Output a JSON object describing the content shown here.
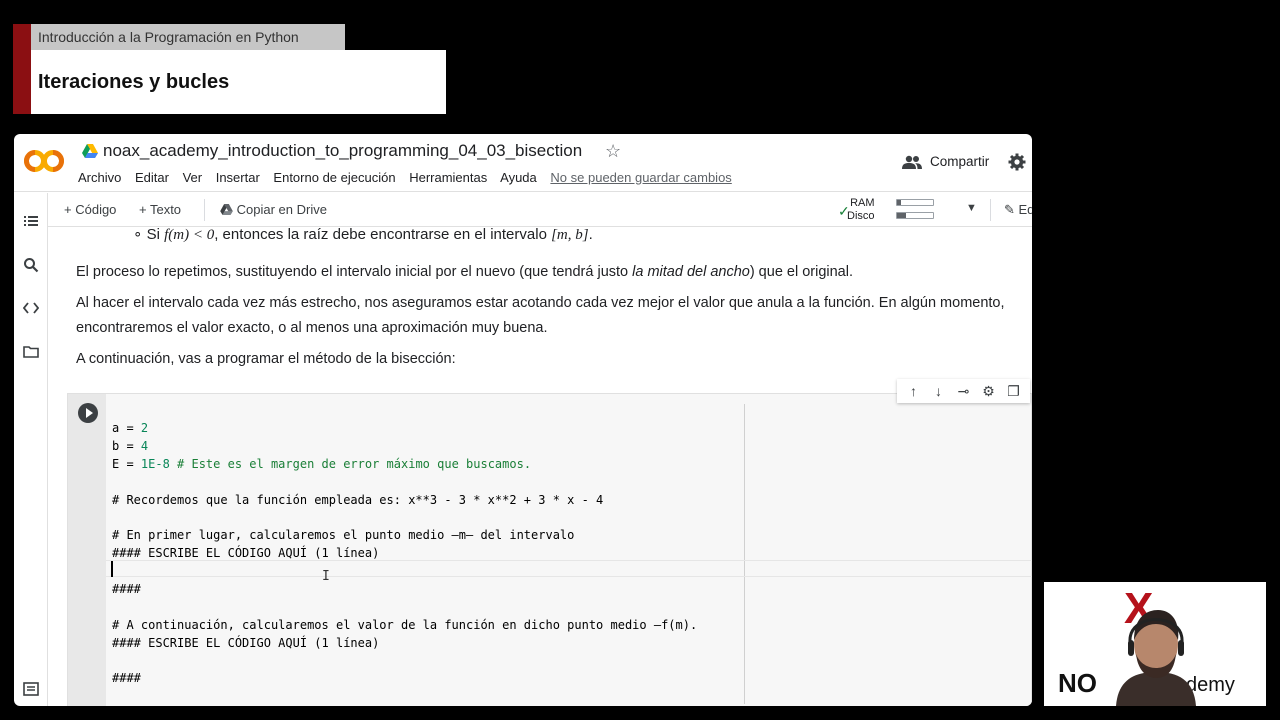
{
  "overlay": {
    "course": "Introducción a la Programación en Python",
    "lesson": "Iteraciones y bucles"
  },
  "header": {
    "notebook_title": "noax_academy_introduction_to_programming_04_03_bisection",
    "menu": [
      "Archivo",
      "Editar",
      "Ver",
      "Insertar",
      "Entorno de ejecución",
      "Herramientas",
      "Ayuda"
    ],
    "unsaved_notice": "No se pueden guardar cambios",
    "share_label": "Compartir"
  },
  "toolbar": {
    "code_label": "Código",
    "text_label": "Texto",
    "drive_label": "Copiar en Drive",
    "ram_label": "RAM",
    "disk_label": "Disco",
    "ram_usage": 0.1,
    "disk_usage": 0.25,
    "edit_label": "Editar"
  },
  "content": {
    "bullet_prefix": "Si",
    "bullet_math": "f(m) < 0",
    "bullet_text": ", entonces la raíz debe encontrarse en el intervalo",
    "bullet_interval": "[m, b]",
    "bullet_end": ".",
    "para1_a": "El proceso lo repetimos, sustituyendo el intervalo inicial por el nuevo (que tendrá justo ",
    "para1_em": "la mitad del ancho",
    "para1_b": ") que el original.",
    "para2_line1": "Al hacer el intervalo cada vez más estrecho, nos aseguramos estar acotando cada vez mejor el valor que anula a la función. En algún momento,",
    "para2_line2": "encontraremos el valor exacto, o al menos una aproximación muy buena.",
    "para3": "A continuación, vas a programar el método de la bisección:"
  },
  "code": {
    "l1_var": "a = ",
    "l1_num": "2",
    "l2_var": "b = ",
    "l2_num": "4",
    "l3_var": "E = ",
    "l3_num": "1E-8",
    "l3_com": " # Este es el margen de error máximo que buscamos.",
    "l5": "# Recordemos que la función empleada es: x**3 - 3 * x**2 + 3 * x - 4",
    "l7": "# En primer lugar, calcularemos el punto medio —m— del intervalo",
    "l8": "#### ESCRIBE EL CÓDIGO AQUÍ (1 línea)",
    "l10": "####",
    "l12": "# A continuación, calcularemos el valor de la función en dicho punto medio —f(m).",
    "l13": "#### ESCRIBE EL CÓDIGO AQUÍ (1 línea)",
    "l15": "####"
  },
  "webcam": {
    "logo_left": "NO",
    "logo_right": "demy"
  }
}
